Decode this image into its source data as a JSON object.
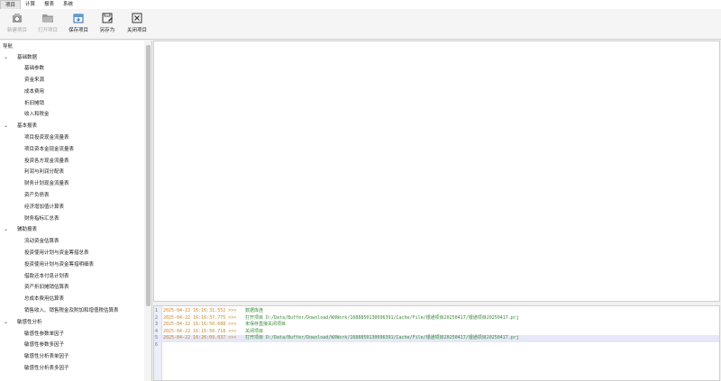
{
  "menubar": [
    "项目",
    "计算",
    "报表",
    "系统"
  ],
  "toolbar": {
    "new": "新建项目",
    "open": "打开项目",
    "save": "保存项目",
    "save_as": "另存为",
    "close": "关闭项目"
  },
  "nav": {
    "title": "导航",
    "groups": [
      {
        "label": "基础数据",
        "items": [
          "基础参数",
          "资金来源",
          "成本费用",
          "折旧摊销",
          "收入和税金"
        ]
      },
      {
        "label": "基本报表",
        "items": [
          "项目投资现金流量表",
          "项目资本金现金流量表",
          "投资各方现金流量表",
          "利润与利润分配表",
          "财务计划现金流量表",
          "资产负债表",
          "经济增加值计算表",
          "财务指标汇总表"
        ]
      },
      {
        "label": "辅助报表",
        "items": [
          "流动资金估算表",
          "投资使用计划与资金筹措总表",
          "投资使用计划与资金筹措明细表",
          "借款还本付息计划表",
          "资产折旧摊销估算表",
          "总成本费用估算表",
          "销售收入、销售税金及附加和增值税估算表"
        ]
      },
      {
        "label": "敏感性分析",
        "items": [
          "敏感性参数单因子",
          "敏感性参数多因子",
          "敏感性分析表单因子",
          "敏感性分析表多因子"
        ]
      }
    ]
  },
  "log": {
    "lines": [
      {
        "num": "1",
        "ts": "2025-04-22 16:16:31.552 >>>",
        "msg": "数据库连"
      },
      {
        "num": "2",
        "ts": "2025-04-22 16:16:37.775 >>>",
        "msg": "打开项目 D:/Data/Buffer/Download/WXWork/1688850130096391/Cache/File/银通项目20250417/银通项目20250417.prj"
      },
      {
        "num": "3",
        "ts": "2025-04-22 16:16:50.688 >>>",
        "msg": "未保存直接关闭项目"
      },
      {
        "num": "4",
        "ts": "2025-04-22 16:16:50.718 >>>",
        "msg": "关闭项目"
      },
      {
        "num": "5",
        "ts": "2025-04-22 16:26:09.037 >>>",
        "msg": "打开项目 D:/Data/Buffer/Download/WXWork/1688850130096391/Cache/File/银通项目20250417/银通项目20250417.prj"
      },
      {
        "num": "6",
        "ts": "",
        "msg": ""
      }
    ]
  },
  "colors": {
    "timestamp": "#c8872a",
    "message": "#3a8a3a",
    "highlight_line": "#e6e8f8"
  }
}
